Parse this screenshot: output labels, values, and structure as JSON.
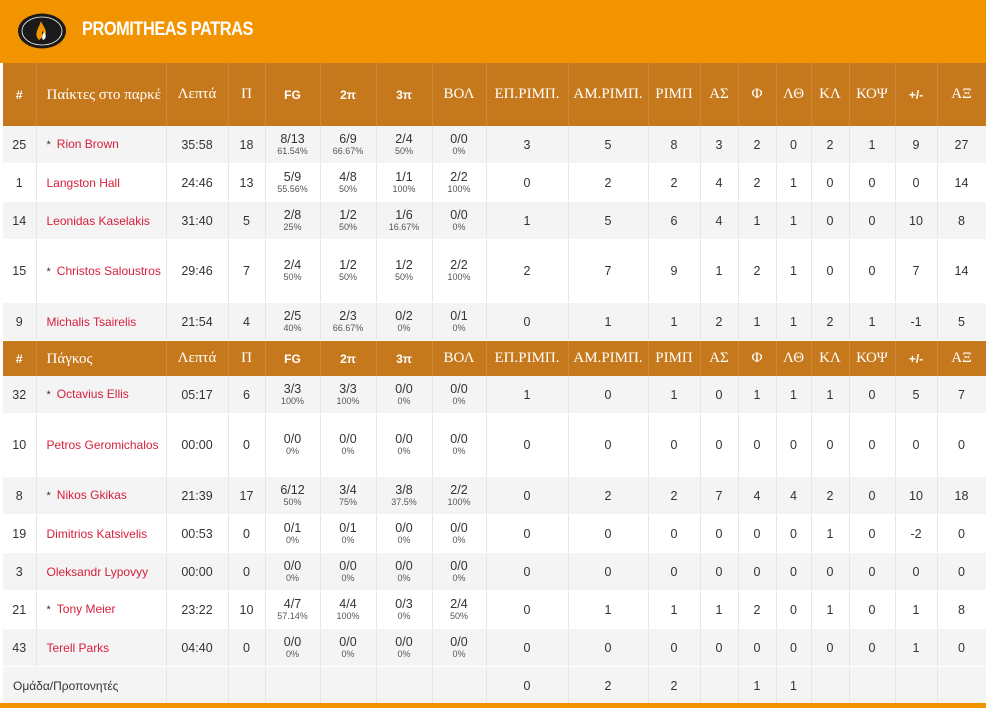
{
  "team": {
    "name": "PROMITHEAS PATRAS",
    "logo_text": "PROMITHEAS PATRAS B.C."
  },
  "colors": {
    "brand": "#f29400",
    "header": "#c6791c",
    "name_link": "#d6203c"
  },
  "columns": [
    "#",
    "",
    "Λεπτά",
    "Π",
    "FG",
    "2π",
    "3π",
    "ΒΟΛ",
    "ΕΠ.ΡΙΜΠ.",
    "ΑΜ.ΡΙΜΠ.",
    "ΡΙΜΠ",
    "ΑΣ",
    "Φ",
    "ΛΘ",
    "ΚΛ",
    "ΚΟΨ",
    "+/-",
    "ΑΞ"
  ],
  "starters_label": "Παίκτες στο παρκέ",
  "bench_label": "Πάγκος",
  "starters": [
    {
      "num": "25",
      "starter_mark": "*",
      "name": "Rion Brown",
      "min": "35:58",
      "pts": "18",
      "fg": "8/13",
      "fg_pct": "61.54%",
      "p2": "6/9",
      "p2_pct": "66.67%",
      "p3": "2/4",
      "p3_pct": "50%",
      "ft": "0/0",
      "ft_pct": "0%",
      "oreb": "3",
      "dreb": "5",
      "reb": "8",
      "ast": "3",
      "pf": "2",
      "to": "0",
      "stl": "2",
      "blk": "1",
      "pm": "9",
      "eff": "27"
    },
    {
      "num": "1",
      "starter_mark": "",
      "name": "Langston Hall",
      "min": "24:46",
      "pts": "13",
      "fg": "5/9",
      "fg_pct": "55.56%",
      "p2": "4/8",
      "p2_pct": "50%",
      "p3": "1/1",
      "p3_pct": "100%",
      "ft": "2/2",
      "ft_pct": "100%",
      "oreb": "0",
      "dreb": "2",
      "reb": "2",
      "ast": "4",
      "pf": "2",
      "to": "1",
      "stl": "0",
      "blk": "0",
      "pm": "0",
      "eff": "14"
    },
    {
      "num": "14",
      "starter_mark": "",
      "name": "Leonidas Kaselakis",
      "min": "31:40",
      "pts": "5",
      "fg": "2/8",
      "fg_pct": "25%",
      "p2": "1/2",
      "p2_pct": "50%",
      "p3": "1/6",
      "p3_pct": "16.67%",
      "ft": "0/0",
      "ft_pct": "0%",
      "oreb": "1",
      "dreb": "5",
      "reb": "6",
      "ast": "4",
      "pf": "1",
      "to": "1",
      "stl": "0",
      "blk": "0",
      "pm": "10",
      "eff": "8"
    },
    {
      "num": "15",
      "starter_mark": "*",
      "name": "Christos Saloustros",
      "min": "29:46",
      "pts": "7",
      "fg": "2/4",
      "fg_pct": "50%",
      "p2": "1/2",
      "p2_pct": "50%",
      "p3": "1/2",
      "p3_pct": "50%",
      "ft": "2/2",
      "ft_pct": "100%",
      "oreb": "2",
      "dreb": "7",
      "reb": "9",
      "ast": "1",
      "pf": "2",
      "to": "1",
      "stl": "0",
      "blk": "0",
      "pm": "7",
      "eff": "14"
    },
    {
      "num": "9",
      "starter_mark": "",
      "name": "Michalis Tsairelis",
      "min": "21:54",
      "pts": "4",
      "fg": "2/5",
      "fg_pct": "40%",
      "p2": "2/3",
      "p2_pct": "66.67%",
      "p3": "0/2",
      "p3_pct": "0%",
      "ft": "0/1",
      "ft_pct": "0%",
      "oreb": "0",
      "dreb": "1",
      "reb": "1",
      "ast": "2",
      "pf": "1",
      "to": "1",
      "stl": "2",
      "blk": "1",
      "pm": "-1",
      "eff": "5"
    }
  ],
  "bench": [
    {
      "num": "32",
      "starter_mark": "*",
      "name": "Octavius Ellis",
      "min": "05:17",
      "pts": "6",
      "fg": "3/3",
      "fg_pct": "100%",
      "p2": "3/3",
      "p2_pct": "100%",
      "p3": "0/0",
      "p3_pct": "0%",
      "ft": "0/0",
      "ft_pct": "0%",
      "oreb": "1",
      "dreb": "0",
      "reb": "1",
      "ast": "0",
      "pf": "1",
      "to": "1",
      "stl": "1",
      "blk": "0",
      "pm": "5",
      "eff": "7"
    },
    {
      "num": "10",
      "starter_mark": "",
      "name": "Petros Geromichalos",
      "min": "00:00",
      "pts": "0",
      "fg": "0/0",
      "fg_pct": "0%",
      "p2": "0/0",
      "p2_pct": "0%",
      "p3": "0/0",
      "p3_pct": "0%",
      "ft": "0/0",
      "ft_pct": "0%",
      "oreb": "0",
      "dreb": "0",
      "reb": "0",
      "ast": "0",
      "pf": "0",
      "to": "0",
      "stl": "0",
      "blk": "0",
      "pm": "0",
      "eff": "0"
    },
    {
      "num": "8",
      "starter_mark": "*",
      "name": "Nikos Gkikas",
      "min": "21:39",
      "pts": "17",
      "fg": "6/12",
      "fg_pct": "50%",
      "p2": "3/4",
      "p2_pct": "75%",
      "p3": "3/8",
      "p3_pct": "37.5%",
      "ft": "2/2",
      "ft_pct": "100%",
      "oreb": "0",
      "dreb": "2",
      "reb": "2",
      "ast": "7",
      "pf": "4",
      "to": "4",
      "stl": "2",
      "blk": "0",
      "pm": "10",
      "eff": "18"
    },
    {
      "num": "19",
      "starter_mark": "",
      "name": "Dimitrios Katsivelis",
      "min": "00:53",
      "pts": "0",
      "fg": "0/1",
      "fg_pct": "0%",
      "p2": "0/1",
      "p2_pct": "0%",
      "p3": "0/0",
      "p3_pct": "0%",
      "ft": "0/0",
      "ft_pct": "0%",
      "oreb": "0",
      "dreb": "0",
      "reb": "0",
      "ast": "0",
      "pf": "0",
      "to": "0",
      "stl": "1",
      "blk": "0",
      "pm": "-2",
      "eff": "0"
    },
    {
      "num": "3",
      "starter_mark": "",
      "name": "Oleksandr Lypovyy",
      "min": "00:00",
      "pts": "0",
      "fg": "0/0",
      "fg_pct": "0%",
      "p2": "0/0",
      "p2_pct": "0%",
      "p3": "0/0",
      "p3_pct": "0%",
      "ft": "0/0",
      "ft_pct": "0%",
      "oreb": "0",
      "dreb": "0",
      "reb": "0",
      "ast": "0",
      "pf": "0",
      "to": "0",
      "stl": "0",
      "blk": "0",
      "pm": "0",
      "eff": "0"
    },
    {
      "num": "21",
      "starter_mark": "*",
      "name": "Tony Meier",
      "min": "23:22",
      "pts": "10",
      "fg": "4/7",
      "fg_pct": "57.14%",
      "p2": "4/4",
      "p2_pct": "100%",
      "p3": "0/3",
      "p3_pct": "0%",
      "ft": "2/4",
      "ft_pct": "50%",
      "oreb": "0",
      "dreb": "1",
      "reb": "1",
      "ast": "1",
      "pf": "2",
      "to": "0",
      "stl": "1",
      "blk": "0",
      "pm": "1",
      "eff": "8"
    },
    {
      "num": "43",
      "starter_mark": "",
      "name": "Terell Parks",
      "min": "04:40",
      "pts": "0",
      "fg": "0/0",
      "fg_pct": "0%",
      "p2": "0/0",
      "p2_pct": "0%",
      "p3": "0/0",
      "p3_pct": "0%",
      "ft": "0/0",
      "ft_pct": "0%",
      "oreb": "0",
      "dreb": "0",
      "reb": "0",
      "ast": "0",
      "pf": "0",
      "to": "0",
      "stl": "0",
      "blk": "0",
      "pm": "1",
      "eff": "0"
    }
  ],
  "team_row": {
    "label": "Ομάδα/Προπονητές",
    "oreb": "0",
    "dreb": "2",
    "reb": "2",
    "pf": "1",
    "to": "1"
  }
}
